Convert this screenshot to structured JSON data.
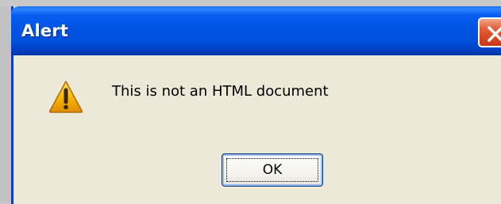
{
  "window": {
    "title": "Alert",
    "close_icon": "close-icon"
  },
  "dialog": {
    "icon": "warning-icon",
    "message": "This is not an HTML document",
    "ok_label": "OK"
  },
  "colors": {
    "titlebar": "#0055e5",
    "dialog_background": "#ece9d8",
    "close_button": "#d8471e",
    "warning_fill": "#f7b500"
  }
}
